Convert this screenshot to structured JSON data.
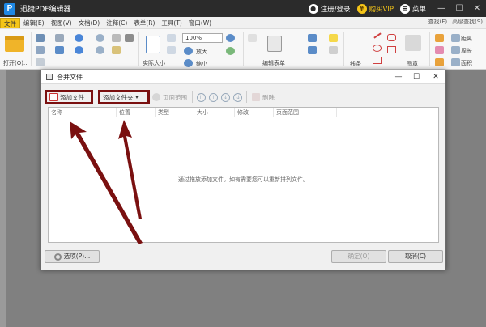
{
  "app": {
    "title": "迅捷PDF编辑器",
    "logo_letter": "P",
    "login_label": "注册/登录",
    "vip_label": "购买VIP",
    "vip_symbol": "¥",
    "menu_label": "菜单",
    "minimize": "—",
    "maximize": "☐",
    "close": "✕"
  },
  "menu": {
    "items": [
      "文件",
      "编辑(E)",
      "视图(V)",
      "文档(D)",
      "注释(C)",
      "表单(R)",
      "工具(T)",
      "窗口(W)"
    ],
    "find": "查找(F)",
    "advanced_find": "高级查找(S)"
  },
  "ribbon": {
    "open_label": "打开(O)...",
    "zoom_value": "100%",
    "zoom_in_label": "放大",
    "zoom_out_label": "缩小",
    "actual_size_label": "实际大小",
    "edit_form_label": "编辑表单",
    "line_label": "线条",
    "stamp_label": "图章",
    "distance_label": "距离",
    "perimeter_label": "周长",
    "area_label": "面积"
  },
  "dialog": {
    "title": "合并文件",
    "toolbar": {
      "add_file": "添加文件",
      "add_folder": "添加文件夹",
      "dropdown_marker": "▾",
      "page_range": "页面范围",
      "move_top": "⇈",
      "move_up": "↑",
      "move_down": "↓",
      "move_bottom": "⇊",
      "delete": "删除"
    },
    "columns": [
      "名称",
      "位置",
      "类型",
      "大小",
      "修改",
      "页面范围"
    ],
    "empty_hint": "通过拖放添加文件。如有需要您可以重新排列文件。",
    "options_button": "选项(P)...",
    "ok_button": "确定(O)",
    "cancel_button": "取消(C)",
    "controls": {
      "minimize": "—",
      "maximize": "☐",
      "close": "✕"
    }
  },
  "colors": {
    "titlebar": "#2b2b2b",
    "accent": "#f5c518",
    "highlight_box": "#7a1010",
    "arrow": "#7a1010"
  }
}
